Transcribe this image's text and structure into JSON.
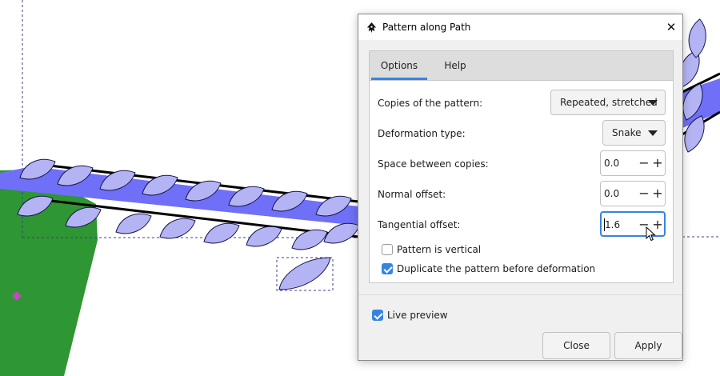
{
  "dialog": {
    "title": "Pattern along Path",
    "app_icon": "inkscape-icon",
    "close_icon": "close-icon",
    "tabs": [
      {
        "label": "Options",
        "active": true
      },
      {
        "label": "Help",
        "active": false
      }
    ],
    "fields": {
      "copies": {
        "label": "Copies of the pattern:",
        "value": "Repeated, stretched"
      },
      "deformation": {
        "label": "Deformation type:",
        "value": "Snake"
      },
      "space": {
        "label": "Space between copies:",
        "value": "0.0"
      },
      "normal": {
        "label": "Normal offset:",
        "value": "0.0"
      },
      "tangential": {
        "label": "Tangential offset:",
        "value": "1.6"
      }
    },
    "stepper_minus": "−",
    "stepper_plus": "+",
    "checkboxes": {
      "vertical": {
        "label": "Pattern is vertical",
        "checked": false
      },
      "duplicate": {
        "label": "Duplicate the pattern before deformation",
        "checked": true
      }
    },
    "live_preview": {
      "label": "Live preview",
      "checked": true
    },
    "buttons": {
      "close": "Close",
      "apply": "Apply"
    }
  },
  "colors": {
    "accent": "#3584e4",
    "leaf_fill": "#b4b4f5",
    "path_band": "#6f6ff7",
    "green_shape": "#2e9632"
  }
}
